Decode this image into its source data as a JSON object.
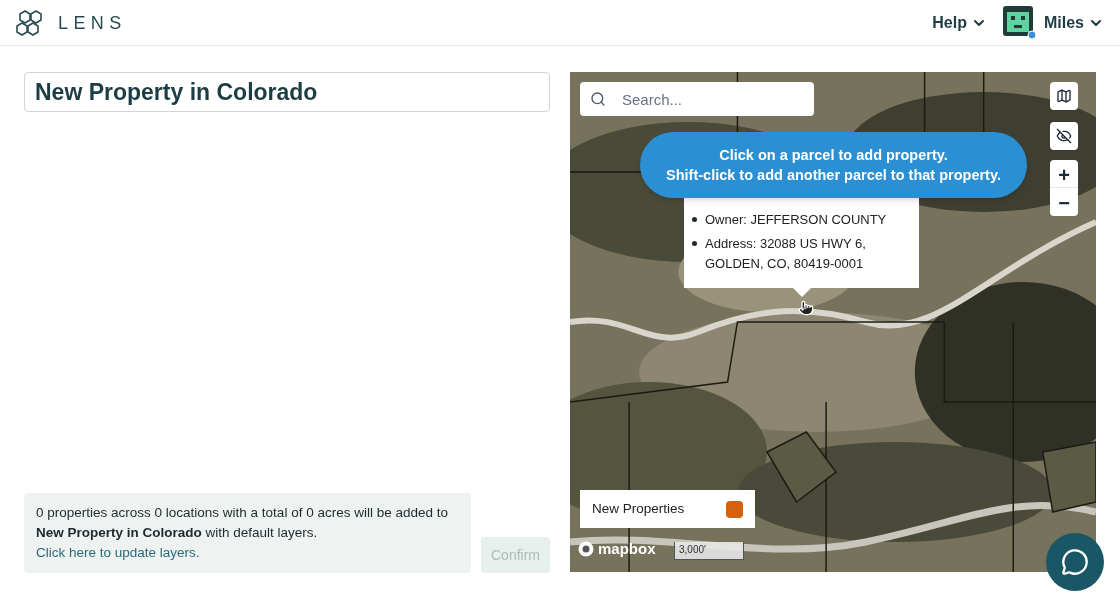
{
  "header": {
    "logo": "LENS",
    "menus": [
      {
        "label": "Help"
      },
      {
        "label": "Miles"
      }
    ]
  },
  "title_field": {
    "value": "New Property in Colorado"
  },
  "summary": {
    "text": "0 properties across 0 locations with a total of 0 acres will be added to **New Property in Colorado** with default layers.",
    "link": "Click here to update layers."
  },
  "confirm_button": {
    "label": "Confirm",
    "disabled": true
  },
  "map": {
    "search": {
      "placeholder": "Search..."
    },
    "hint": [
      "Click on a parcel to add property.",
      "Shift-click to add another parcel to that property."
    ],
    "popup": {
      "items": [
        "Owner: JEFFERSON COUNTY",
        "Address: 32088 US HWY 6, GOLDEN, CO, 80419-0001"
      ]
    },
    "zoom_controls": [
      "+",
      "−"
    ],
    "legend": {
      "label": "New Properties",
      "color": "#d4610f"
    },
    "attribution": "mapbox",
    "scale": "3,000′"
  }
}
